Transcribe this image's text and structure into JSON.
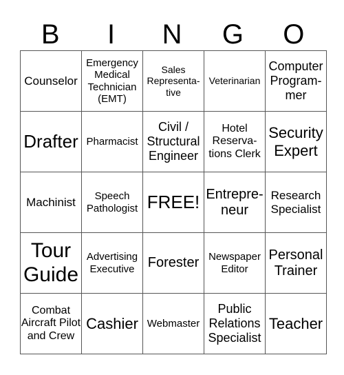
{
  "header": [
    "B",
    "I",
    "N",
    "G",
    "O"
  ],
  "rows": [
    [
      "Counselor",
      "Emergency Medical Technician (EMT)",
      "Sales Representa-tive",
      "Veterinarian",
      "Computer Program-mer"
    ],
    [
      "Drafter",
      "Pharmacist",
      "Civil / Structural Engineer",
      "Hotel Reserva-tions Clerk",
      "Security Expert"
    ],
    [
      "Machinist",
      "Speech Pathologist",
      "FREE!",
      "Entrepre-neur",
      "Research Specialist"
    ],
    [
      "Tour Guide",
      "Advertising Executive",
      "Forester",
      "Newspaper Editor",
      "Personal Trainer"
    ],
    [
      "Combat Aircraft Pilot and Crew",
      "Cashier",
      "Webmaster",
      "Public Relations Specialist",
      "Teacher"
    ]
  ]
}
